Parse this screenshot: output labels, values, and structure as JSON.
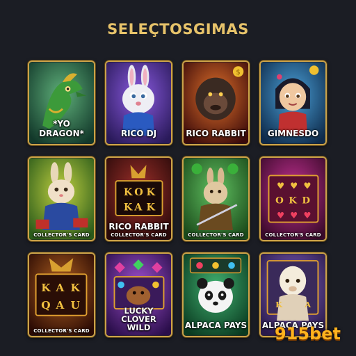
{
  "header": {
    "title": "SELEÇTOSGIMAS"
  },
  "cards": [
    {
      "name": "*YO DRAGON*",
      "bg": "#2a6a4a",
      "theme": "dragon-art"
    },
    {
      "name": "RICO DJ",
      "bg": "#4a2d8c",
      "theme": "rabbit-dj-art"
    },
    {
      "name": "RICO RABBIT",
      "bg": "#8a2a12",
      "theme": "gorilla-art"
    },
    {
      "name": "GIMNESDO",
      "bg": "#1e5a8a",
      "theme": "girl-art"
    },
    {
      "name": "",
      "sub": "COLLECTOR'S CARD",
      "bg": "#3a7a2a",
      "theme": "rabbit-art"
    },
    {
      "name": "RICO RABBIT",
      "sub": "COLLECTOR'S CARD",
      "bg": "#5a1a1a",
      "theme": "slot-reels-art"
    },
    {
      "name": "",
      "sub": "COLLECTOR'S CARD",
      "bg": "#2a6a3a",
      "theme": "rabbit-sword-art"
    },
    {
      "name": "",
      "sub": "COLLECTOR'S CARD",
      "bg": "#7a1a5a",
      "theme": "slot-hearts-art"
    },
    {
      "name": "",
      "sub": "COLLECTOR'S CARD",
      "bg": "#5a2a0a",
      "theme": "slot-letters-art"
    },
    {
      "name": "LUCKY CLOVER\nWILD",
      "bg": "#5a2a7a",
      "theme": "gems-art"
    },
    {
      "name": "ALPACA PAYS",
      "bg": "#1a5a3a",
      "theme": "panda-art"
    },
    {
      "name": "ALPACA PAYS",
      "bg": "#4a2a6a",
      "theme": "alpaca-art"
    }
  ],
  "watermark": {
    "text": "915bet",
    "color": "#ffb21e"
  }
}
